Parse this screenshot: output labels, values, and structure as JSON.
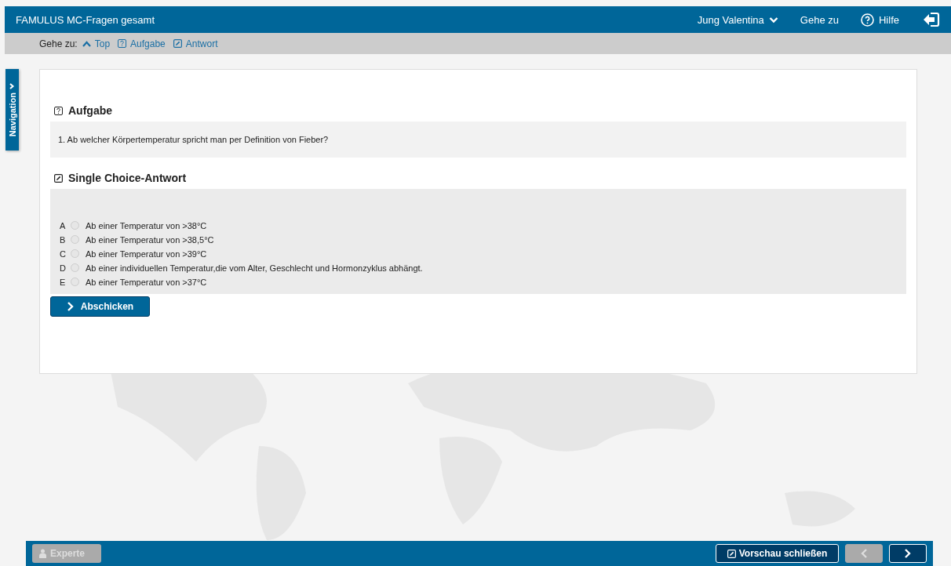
{
  "header": {
    "title": "FAMULUS MC-Fragen gesamt",
    "user": "Jung Valentina",
    "goto": "Gehe zu",
    "help": "Hilfe"
  },
  "jumpbar": {
    "label": "Gehe zu:",
    "links": [
      {
        "kind": "top",
        "label": "Top"
      },
      {
        "kind": "task",
        "label": "Aufgabe"
      },
      {
        "kind": "answer",
        "label": "Antwort"
      }
    ]
  },
  "navigation_tab": {
    "label": "Navigation"
  },
  "task": {
    "heading": "Aufgabe",
    "question": "1. Ab welcher Körpertemperatur spricht man per Definition von Fieber?"
  },
  "answer": {
    "heading": "Single Choice-Antwort",
    "options": [
      {
        "letter": "A",
        "text": "Ab einer Temperatur von >38°C",
        "selected": false
      },
      {
        "letter": "B",
        "text": "Ab einer Temperatur von >38,5°C",
        "selected": false
      },
      {
        "letter": "C",
        "text": "Ab einer Temperatur von >39°C",
        "selected": false
      },
      {
        "letter": "D",
        "text": "Ab einer individuellen Temperatur,die vom Alter, Geschlecht und Hormonzyklus abhängt.",
        "selected": false
      },
      {
        "letter": "E",
        "text": "Ab einer Temperatur von >37°C",
        "selected": false
      }
    ],
    "submit": "Abschicken"
  },
  "footer": {
    "expert": {
      "label": "Experte",
      "disabled": true
    },
    "close_preview": "Vorschau schließen",
    "prev": {
      "disabled": true
    },
    "next": {
      "disabled": false
    }
  }
}
